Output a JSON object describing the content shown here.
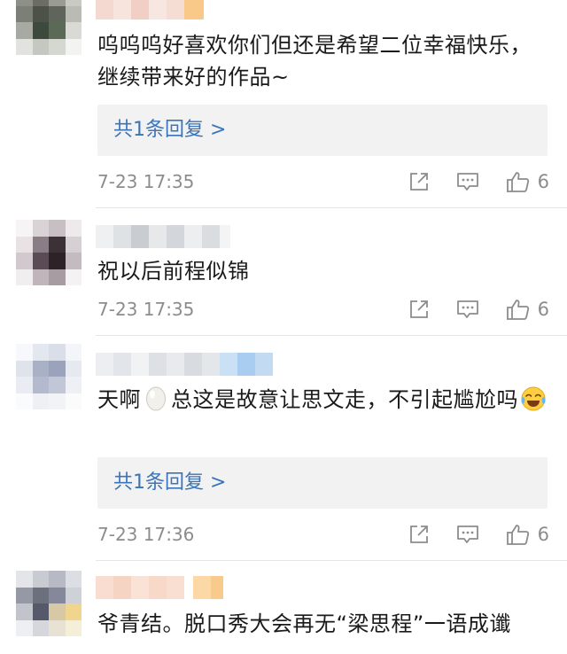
{
  "colors": {
    "text": "#1a1a1a",
    "meta": "#8c8c8c",
    "link": "#3c74b9",
    "reply_bg": "#f2f2f2",
    "divider": "#e6e6e6"
  },
  "comments": [
    {
      "text": "呜呜呜好喜欢你们但还是希望二位幸福快乐，继续带来好的作品~",
      "reply_link": "共1条回复 >",
      "time": "7-23 17:35",
      "likes": "6"
    },
    {
      "text": "祝以后前程似锦",
      "time": "7-23 17:35",
      "likes": "6"
    },
    {
      "text_a": "天啊",
      "text_b": "总这是故意让思文走，不引起尴尬吗",
      "reply_link": "共1条回复 >",
      "time": "7-23 17:36",
      "likes": "6"
    },
    {
      "text": "爷青结。脱口秀大会再无“梁思程”一语成谶"
    }
  ],
  "icons": {
    "share": "share-icon",
    "comment": "comment-icon",
    "like": "thumbs-up-icon",
    "egg": "egg-emoji",
    "cry_laugh": "crying-laughing-emoji"
  }
}
